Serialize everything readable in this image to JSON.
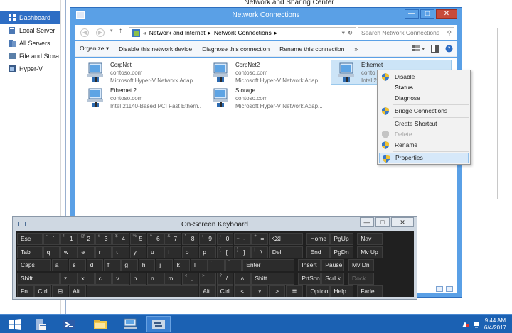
{
  "server_manager": {
    "items": [
      {
        "label": "Dashboard",
        "icon": "dashboard-icon",
        "active": true
      },
      {
        "label": "Local Server",
        "icon": "server-icon"
      },
      {
        "label": "All Servers",
        "icon": "servers-icon"
      },
      {
        "label": "File and Stora",
        "icon": "file-storage-icon"
      },
      {
        "label": "Hyper-V",
        "icon": "hyperv-icon"
      }
    ]
  },
  "background_window": {
    "title": "Network and Sharing Center"
  },
  "network_connections": {
    "title": "Network Connections",
    "window_buttons": {
      "minimize": "—",
      "maximize": "□",
      "close": "✕"
    },
    "address": {
      "prefix": "«",
      "crumb1": "Network and Internet",
      "sep": "▸",
      "crumb2": "Network Connections"
    },
    "search_placeholder": "Search Network Connections",
    "commands": {
      "organize": "Organize ▾",
      "disable": "Disable this network device",
      "diagnose": "Diagnose this connection",
      "rename": "Rename this connection",
      "more": "»"
    },
    "connections": [
      {
        "name": "CorpNet",
        "domain": "contoso.com",
        "adapter": "Microsoft Hyper-V Network Adap..."
      },
      {
        "name": "CorpNet2",
        "domain": "contoso.com",
        "adapter": "Microsoft Hyper-V Network Adap..."
      },
      {
        "name": "Ethernet",
        "domain": "conto",
        "adapter": "Intel 21"
      },
      {
        "name": "Ethernet 2",
        "domain": "contoso.com",
        "adapter": "Intel 21140-Based PCI Fast Ethern..."
      },
      {
        "name": "Storage",
        "domain": "contoso.com",
        "adapter": "Microsoft Hyper-V Network Adap..."
      }
    ]
  },
  "context_menu": {
    "items": [
      {
        "label": "Disable",
        "shield": true
      },
      {
        "label": "Status",
        "bold": true
      },
      {
        "label": "Diagnose"
      },
      {
        "label": "Bridge Connections",
        "shield": true
      },
      {
        "label": "Create Shortcut"
      },
      {
        "label": "Delete",
        "shield": true,
        "disabled": true
      },
      {
        "label": "Rename",
        "shield": true
      },
      {
        "label": "Properties",
        "shield": true,
        "highlighted": true
      }
    ]
  },
  "osk": {
    "title": "On-Screen Keyboard",
    "buttons": {
      "minimize": "—",
      "maximize": "□",
      "close": "✕"
    },
    "keys": {
      "esc": "Esc",
      "tilde": "`",
      "k1": "1",
      "k2": "2",
      "k3": "3",
      "k4": "4",
      "k5": "5",
      "k6": "6",
      "k7": "7",
      "k8": "8",
      "k9": "9",
      "k0": "0",
      "minus": "-",
      "equal": "=",
      "bksp": "⌫",
      "home": "Home",
      "pgup": "PgUp",
      "nav": "Nav",
      "tab": "Tab",
      "q": "q",
      "w": "w",
      "e": "e",
      "r": "r",
      "t": "t",
      "y": "y",
      "u": "u",
      "i": "i",
      "o": "o",
      "p": "p",
      "lbr": "[",
      "rbr": "]",
      "bsl": "\\",
      "del": "Del",
      "end": "End",
      "pgdn": "PgDn",
      "mvup": "Mv Up",
      "caps": "Caps",
      "a": "a",
      "s": "s",
      "d": "d",
      "f": "f",
      "g": "g",
      "h": "h",
      "j": "j",
      "k": "k",
      "l": "l",
      "semi": ";",
      "apos": "'",
      "enter": "Enter",
      "insert": "Insert",
      "pause": "Pause",
      "mvdn": "Mv Dn",
      "shift": "Shift",
      "z": "z",
      "x": "x",
      "c": "c",
      "v": "v",
      "b": "b",
      "n": "n",
      "m": "m",
      "comma": ",",
      "period": ".",
      "slash": "/",
      "up": "˄",
      "shift2": "Shift",
      "prtscn": "PrtScn",
      "scrlk": "ScrLk",
      "dock": "Dock",
      "fn": "Fn",
      "ctrl": "Ctrl",
      "win": "⊞",
      "alt": "Alt",
      "alt2": "Alt",
      "ctrl2": "Ctrl",
      "left": "˂",
      "down": "˅",
      "right": "˃",
      "menu": "≣",
      "options": "Options",
      "help": "Help",
      "fade": "Fade"
    },
    "shift_symbols": {
      "tilde": "~",
      "k1": "!",
      "k2": "@",
      "k3": "#",
      "k4": "$",
      "k5": "%",
      "k6": "^",
      "k7": "&",
      "k8": "*",
      "k9": "(",
      "k0": ")",
      "minus": "_",
      "equal": "+",
      "lbr": "{",
      "rbr": "}",
      "bsl": "|",
      "semi": ":",
      "apos": "\"",
      "comma": "<",
      "period": ">",
      "slash": "?"
    }
  },
  "taskbar": {
    "clock_time": "9:44 AM",
    "clock_date": "6/4/2017"
  }
}
